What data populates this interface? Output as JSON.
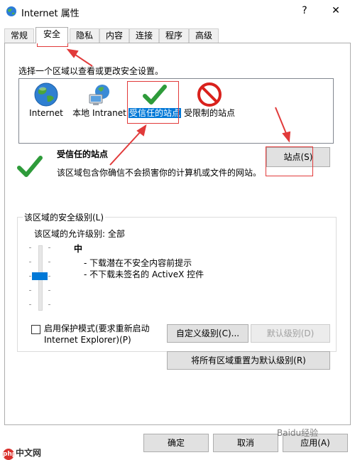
{
  "window": {
    "title": "Internet 属性",
    "help_glyph": "?",
    "close_glyph": "✕"
  },
  "tabs": [
    {
      "label": "常规"
    },
    {
      "label": "安全"
    },
    {
      "label": "隐私"
    },
    {
      "label": "内容"
    },
    {
      "label": "连接"
    },
    {
      "label": "程序"
    },
    {
      "label": "高级"
    }
  ],
  "active_tab": "安全",
  "zones": {
    "prompt": "选择一个区域以查看或更改安全设置。",
    "items": [
      {
        "label": "Internet",
        "icon": "globe-icon"
      },
      {
        "label": "本地 Intranet",
        "icon": "intranet-icon"
      },
      {
        "label": "受信任的站点",
        "icon": "checkmark-icon"
      },
      {
        "label": "受限制的站点",
        "icon": "restricted-icon"
      }
    ],
    "selected": "受信任的站点"
  },
  "zone_detail": {
    "title": "受信任的站点",
    "description": "该区域包含你确信不会损害你的计算机或文件的网站。",
    "sites_button": "站点(S)"
  },
  "security_level": {
    "group_title": "该区域的安全级别(L)",
    "allowed_label": "该区域的允许级别: 全部",
    "level_name": "中",
    "level_items": [
      "- 下载潜在不安全内容前提示",
      "- 不下载未签名的 ActiveX 控件"
    ],
    "slider_level_fraction": 0.5,
    "protected_mode_label": "启用保护模式(要求重新启动 Internet Explorer)(P)",
    "protected_mode_checked": false,
    "custom_level_button": "自定义级别(C)...",
    "default_level_button": "默认级别(D)",
    "reset_all_button": "将所有区域重置为默认级别(R)"
  },
  "footer": {
    "ok": "确定",
    "cancel": "取消",
    "apply": "应用(A)"
  },
  "watermarks": {
    "left_badge": "php",
    "left_text": "中文网",
    "right_text": "Baidu经验"
  },
  "colors": {
    "accent": "#0078d7",
    "annotation": "#e13a3a",
    "check_green": "#2e9b3a",
    "restricted_red": "#d9211c"
  }
}
